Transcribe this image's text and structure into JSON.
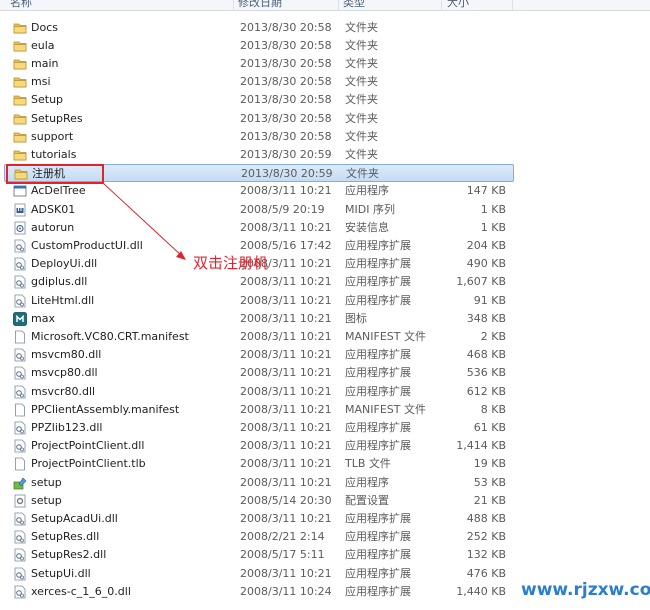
{
  "columns": {
    "name": "名称",
    "date": "修改日期",
    "type": "类型",
    "size": "大小"
  },
  "rows": [
    {
      "name": "Docs",
      "date": "2013/8/30 20:58",
      "type": "文件夹",
      "size": "",
      "icon": "folder-icon"
    },
    {
      "name": "eula",
      "date": "2013/8/30 20:58",
      "type": "文件夹",
      "size": "",
      "icon": "folder-icon"
    },
    {
      "name": "main",
      "date": "2013/8/30 20:58",
      "type": "文件夹",
      "size": "",
      "icon": "folder-icon"
    },
    {
      "name": "msi",
      "date": "2013/8/30 20:58",
      "type": "文件夹",
      "size": "",
      "icon": "folder-icon"
    },
    {
      "name": "Setup",
      "date": "2013/8/30 20:58",
      "type": "文件夹",
      "size": "",
      "icon": "folder-icon"
    },
    {
      "name": "SetupRes",
      "date": "2013/8/30 20:58",
      "type": "文件夹",
      "size": "",
      "icon": "folder-icon"
    },
    {
      "name": "support",
      "date": "2013/8/30 20:58",
      "type": "文件夹",
      "size": "",
      "icon": "folder-icon"
    },
    {
      "name": "tutorials",
      "date": "2013/8/30 20:59",
      "type": "文件夹",
      "size": "",
      "icon": "folder-icon"
    },
    {
      "name": "注册机",
      "date": "2013/8/30 20:59",
      "type": "文件夹",
      "size": "",
      "icon": "folder-icon",
      "selected": true
    },
    {
      "name": "AcDelTree",
      "date": "2008/3/11 10:21",
      "type": "应用程序",
      "size": "147 KB",
      "icon": "application-icon"
    },
    {
      "name": "ADSK01",
      "date": "2008/5/9 20:19",
      "type": "MIDI 序列",
      "size": "1 KB",
      "icon": "midi-file-icon"
    },
    {
      "name": "autorun",
      "date": "2008/3/11 10:21",
      "type": "安装信息",
      "size": "1 KB",
      "icon": "setup-info-icon"
    },
    {
      "name": "CustomProductUI.dll",
      "date": "2008/5/16 17:42",
      "type": "应用程序扩展",
      "size": "204 KB",
      "icon": "dll-file-icon"
    },
    {
      "name": "DeployUi.dll",
      "date": "2008/3/11 10:21",
      "type": "应用程序扩展",
      "size": "490 KB",
      "icon": "dll-file-icon"
    },
    {
      "name": "gdiplus.dll",
      "date": "2008/3/11 10:21",
      "type": "应用程序扩展",
      "size": "1,607 KB",
      "icon": "dll-file-icon"
    },
    {
      "name": "LiteHtml.dll",
      "date": "2008/3/11 10:21",
      "type": "应用程序扩展",
      "size": "91 KB",
      "icon": "dll-file-icon"
    },
    {
      "name": "max",
      "date": "2008/3/11 10:21",
      "type": "图标",
      "size": "348 KB",
      "icon": "max-icon"
    },
    {
      "name": "Microsoft.VC80.CRT.manifest",
      "date": "2008/3/11 10:21",
      "type": "MANIFEST 文件",
      "size": "2 KB",
      "icon": "blank-file-icon"
    },
    {
      "name": "msvcm80.dll",
      "date": "2008/3/11 10:21",
      "type": "应用程序扩展",
      "size": "468 KB",
      "icon": "dll-file-icon"
    },
    {
      "name": "msvcp80.dll",
      "date": "2008/3/11 10:21",
      "type": "应用程序扩展",
      "size": "536 KB",
      "icon": "dll-file-icon"
    },
    {
      "name": "msvcr80.dll",
      "date": "2008/3/11 10:21",
      "type": "应用程序扩展",
      "size": "612 KB",
      "icon": "dll-file-icon"
    },
    {
      "name": "PPClientAssembly.manifest",
      "date": "2008/3/11 10:21",
      "type": "MANIFEST 文件",
      "size": "8 KB",
      "icon": "blank-file-icon"
    },
    {
      "name": "PPZlib123.dll",
      "date": "2008/3/11 10:21",
      "type": "应用程序扩展",
      "size": "61 KB",
      "icon": "dll-file-icon"
    },
    {
      "name": "ProjectPointClient.dll",
      "date": "2008/3/11 10:21",
      "type": "应用程序扩展",
      "size": "1,414 KB",
      "icon": "dll-file-icon"
    },
    {
      "name": "ProjectPointClient.tlb",
      "date": "2008/3/11 10:21",
      "type": "TLB 文件",
      "size": "19 KB",
      "icon": "blank-file-icon"
    },
    {
      "name": "setup",
      "date": "2008/3/11 10:21",
      "type": "应用程序",
      "size": "53 KB",
      "icon": "setup-app-icon"
    },
    {
      "name": "setup",
      "date": "2008/5/14 20:30",
      "type": "配置设置",
      "size": "21 KB",
      "icon": "config-file-icon"
    },
    {
      "name": "SetupAcadUi.dll",
      "date": "2008/3/11 10:21",
      "type": "应用程序扩展",
      "size": "488 KB",
      "icon": "dll-file-icon"
    },
    {
      "name": "SetupRes.dll",
      "date": "2008/2/21 2:14",
      "type": "应用程序扩展",
      "size": "252 KB",
      "icon": "dll-file-icon"
    },
    {
      "name": "SetupRes2.dll",
      "date": "2008/5/17 5:11",
      "type": "应用程序扩展",
      "size": "132 KB",
      "icon": "dll-file-icon"
    },
    {
      "name": "SetupUi.dll",
      "date": "2008/3/11 10:21",
      "type": "应用程序扩展",
      "size": "476 KB",
      "icon": "dll-file-icon"
    },
    {
      "name": "xerces-c_1_6_0.dll",
      "date": "2008/3/11 10:24",
      "type": "应用程序扩展",
      "size": "1,440 KB",
      "icon": "dll-file-icon"
    }
  ],
  "annotation": {
    "text": "双击注册机",
    "color": "#e0242c"
  },
  "watermark": {
    "text": "www.rjzxw.com",
    "color": "#2a7ed0"
  },
  "colors": {
    "selection": "#cfe3f8",
    "selection_border": "#84acdd",
    "folder": "#e8c25a"
  }
}
